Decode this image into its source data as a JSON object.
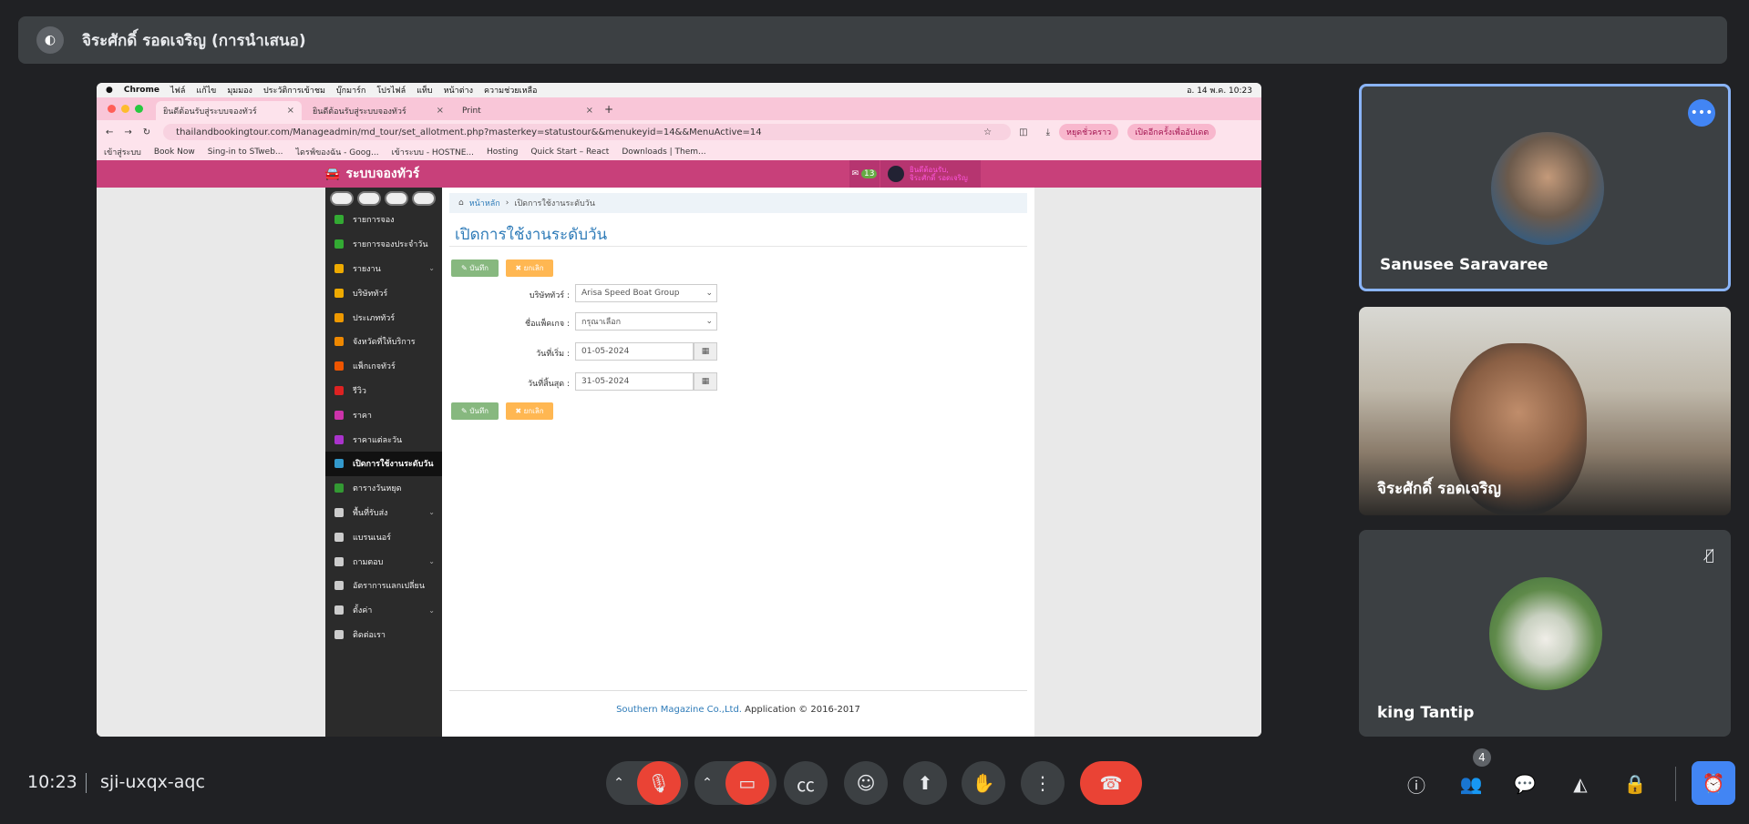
{
  "meet": {
    "presenter_title": "จิระศักดิ์ รอดเจริญ (การนำเสนอ)",
    "time": "10:23",
    "meeting_code": "sji-uxqx-aqc",
    "participant_count": "4",
    "participants": [
      {
        "name": "Sanusee Saravaree"
      },
      {
        "name": "จิระศักดิ์ รอดเจริญ"
      },
      {
        "name": "king Tantip"
      }
    ]
  },
  "mac_menu": [
    "Chrome",
    "ไฟล์",
    "แก้ไข",
    "มุมมอง",
    "ประวัติการเข้าชม",
    "บุ๊กมาร์ก",
    "โปรไฟล์",
    "แท็บ",
    "หน้าต่าง",
    "ความช่วยเหลือ"
  ],
  "mac_clock": "อ. 14 พ.ค. 10:23",
  "browser": {
    "tabs": [
      {
        "label": "ยินดีต้อนรับสู่ระบบจองทัวร์"
      },
      {
        "label": "ยินดีต้อนรับสู่ระบบจองทัวร์"
      },
      {
        "label": "Print"
      }
    ],
    "url": "thailandbookingtour.com/Manageadmin/md_tour/set_allotment.php?masterkey=statustour&&menukeyid=14&&MenuActive=14",
    "pause_label": "หยุดชั่วคราว",
    "update_label": "เปิดอีกครั้งเพื่ออัปเดต",
    "bookmarks": [
      "เข้าสู่ระบบ",
      "Book Now",
      "Sing-in to STweb...",
      "ไดรฟ์ของฉัน - Goog...",
      "เข้าระบบ - HOSTNE...",
      "Hosting",
      "Quick Start – React",
      "Downloads | Them..."
    ]
  },
  "app": {
    "brand": "ระบบจองทัวร์",
    "mail_count": "13",
    "user_line1": "ยินดีต้อนรับ,",
    "user_line2": "จิระศักดิ์ รอดเจริญ",
    "menu": [
      {
        "label": "รายการจอง",
        "color": "#3a3"
      },
      {
        "label": "รายการจองประจำวัน",
        "color": "#3a3"
      },
      {
        "label": "รายงาน",
        "color": "#ea0"
      },
      {
        "label": "บริษัททัวร์",
        "color": "#ea0"
      },
      {
        "label": "ประเภททัวร์",
        "color": "#e90"
      },
      {
        "label": "จังหวัดที่ให้บริการ",
        "color": "#e80"
      },
      {
        "label": "แพ็กเกจทัวร์",
        "color": "#e50"
      },
      {
        "label": "รีวิว",
        "color": "#d22"
      },
      {
        "label": "ราคา",
        "color": "#c3a"
      },
      {
        "label": "ราคาแต่ละวัน",
        "color": "#a3c"
      },
      {
        "label": "เปิดการใช้งานระดับวัน",
        "color": "#39c"
      },
      {
        "label": "ตารางวันหยุด",
        "color": "#393"
      },
      {
        "label": "พื้นที่รับส่ง",
        "color": "#ccc"
      },
      {
        "label": "แบรนเนอร์",
        "color": "#ccc"
      },
      {
        "label": "ถามตอบ",
        "color": "#ccc"
      },
      {
        "label": "อัตราการแลกเปลี่ยน",
        "color": "#ccc"
      },
      {
        "label": "ตั้งค่า",
        "color": "#ccc"
      },
      {
        "label": "ติดต่อเรา",
        "color": "#ccc"
      }
    ],
    "breadcrumb_home": "หน้าหลัก",
    "breadcrumb_current": "เปิดการใช้งานระดับวัน",
    "page_title": "เปิดการใช้งานระดับวัน",
    "save_label": "บันทึก",
    "cancel_label": "ยกเลิก",
    "form": {
      "company_label": "บริษัททัวร์ :",
      "company_value": "Arisa Speed Boat Group",
      "package_label": "ชื่อแพ็คเกจ :",
      "package_value": "กรุณาเลือก",
      "start_label": "วันที่เริ่ม :",
      "start_value": "01-05-2024",
      "end_label": "วันที่สิ้นสุด :",
      "end_value": "31-05-2024"
    },
    "footer_company": "Southern Magazine Co.,Ltd.",
    "footer_text": "Application © 2016-2017"
  }
}
